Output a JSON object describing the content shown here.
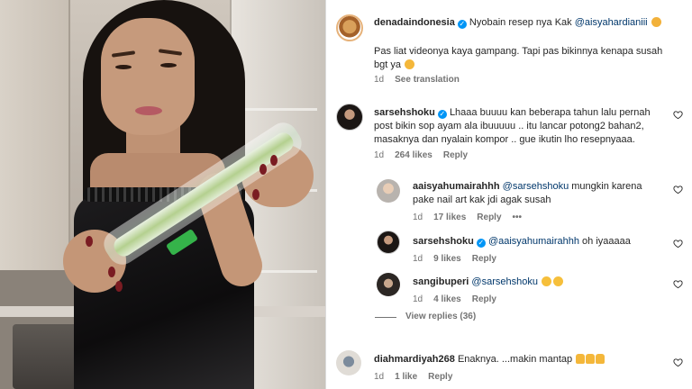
{
  "comments": [
    {
      "username": "denadaindonesia",
      "verified": true,
      "text_before": "Nyobain resep nya Kak ",
      "mention": "@aisyahardianiii",
      "text_line2": "Pas liat videonya kaya gampang. Tapi pas bikinnya kenapa susah",
      "text_line3": "bgt ya",
      "time": "1d",
      "action": "See translation"
    },
    {
      "username": "sarsehshoku",
      "verified": true,
      "line1": "Lhaaa buuuu kan beberapa tahun lalu pernah",
      "line2": "post bikin sop ayam ala ibuuuuu .. itu lancar potong2 bahan2,",
      "line3": "masaknya dan nyalain kompor .. gue ikutin lho resepnyaaa.",
      "time": "1d",
      "likes": "264 likes",
      "reply": "Reply"
    },
    {
      "username": "aaisyahumairahhh",
      "mention": "@sarsehshoku",
      "line1_after": " mungkin karena",
      "line2": "pake nail art kak jdi agak susah",
      "time": "1d",
      "likes": "17 likes",
      "reply": "Reply",
      "more": "•••"
    },
    {
      "username": "sarsehshoku",
      "verified": true,
      "mention": "@aaisyahumairahhh",
      "text_after": " oh iyaaaaa",
      "time": "1d",
      "likes": "9 likes",
      "reply": "Reply"
    },
    {
      "username": "sangibuperi",
      "mention": "@sarsehshoku",
      "time": "1d",
      "likes": "4 likes",
      "reply": "Reply"
    },
    {
      "username": "diahmardiyah268",
      "text": "Enaknya. ...makin mantap",
      "time": "1d",
      "likes": "1 like",
      "reply": "Reply"
    }
  ],
  "view_replies": "View replies (36)",
  "icons": {
    "heart": "heart-outline-icon",
    "verified": "verified-badge-icon"
  },
  "colors": {
    "mention": "#00376b",
    "verified": "#0095f6",
    "meta": "#737373"
  }
}
